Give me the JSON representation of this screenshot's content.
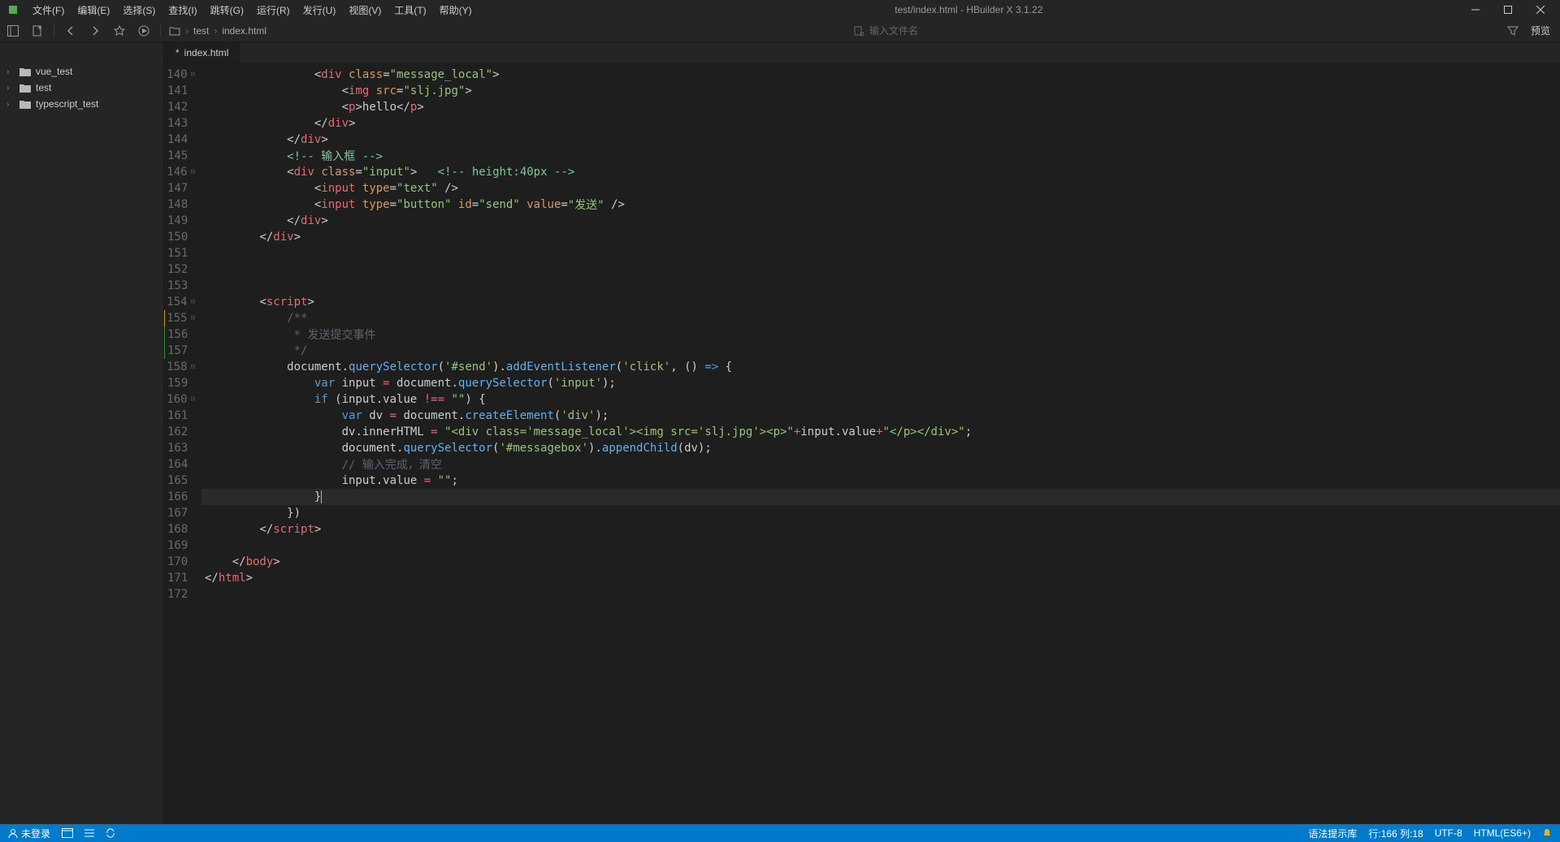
{
  "menubar": {
    "items": [
      "文件(F)",
      "编辑(E)",
      "选择(S)",
      "查找(I)",
      "跳转(G)",
      "运行(R)",
      "发行(U)",
      "视图(V)",
      "工具(T)",
      "帮助(Y)"
    ],
    "title": "test/index.html - HBuilder X 3.1.22"
  },
  "toolbar": {
    "breadcrumb": [
      "test",
      "index.html"
    ],
    "search_placeholder": "输入文件名",
    "preview_label": "预览"
  },
  "sidebar": {
    "items": [
      {
        "label": "vue_test"
      },
      {
        "label": "test"
      },
      {
        "label": "typescript_test"
      }
    ]
  },
  "tabs": {
    "items": [
      {
        "label": "index.html",
        "dirty_prefix": "* "
      }
    ]
  },
  "gutter": {
    "start": 140,
    "end": 172,
    "folds_at": [
      140,
      146,
      154,
      155,
      158,
      160
    ],
    "changes": {
      "155": "orange",
      "156": "green",
      "157": "green"
    }
  },
  "code": {
    "lines": [
      {
        "n": 140,
        "seg": [
          {
            "t": "plain",
            "v": "                "
          },
          {
            "t": "punc",
            "v": "<"
          },
          {
            "t": "tag",
            "v": "div"
          },
          {
            "t": "plain",
            "v": " "
          },
          {
            "t": "attr",
            "v": "class"
          },
          {
            "t": "punc",
            "v": "="
          },
          {
            "t": "str",
            "v": "\"message_local\""
          },
          {
            "t": "punc",
            "v": ">"
          }
        ]
      },
      {
        "n": 141,
        "seg": [
          {
            "t": "plain",
            "v": "                    "
          },
          {
            "t": "punc",
            "v": "<"
          },
          {
            "t": "tag",
            "v": "img"
          },
          {
            "t": "plain",
            "v": " "
          },
          {
            "t": "attr",
            "v": "src"
          },
          {
            "t": "punc",
            "v": "="
          },
          {
            "t": "str",
            "v": "\"slj.jpg\""
          },
          {
            "t": "punc",
            "v": ">"
          }
        ]
      },
      {
        "n": 142,
        "seg": [
          {
            "t": "plain",
            "v": "                    "
          },
          {
            "t": "punc",
            "v": "<"
          },
          {
            "t": "tag",
            "v": "p"
          },
          {
            "t": "punc",
            "v": ">"
          },
          {
            "t": "plain",
            "v": "hello"
          },
          {
            "t": "punc",
            "v": "</"
          },
          {
            "t": "tag",
            "v": "p"
          },
          {
            "t": "punc",
            "v": ">"
          }
        ]
      },
      {
        "n": 143,
        "seg": [
          {
            "t": "plain",
            "v": "                "
          },
          {
            "t": "punc",
            "v": "</"
          },
          {
            "t": "tag",
            "v": "div"
          },
          {
            "t": "punc",
            "v": ">"
          }
        ]
      },
      {
        "n": 144,
        "seg": [
          {
            "t": "plain",
            "v": "            "
          },
          {
            "t": "punc",
            "v": "</"
          },
          {
            "t": "tag",
            "v": "div"
          },
          {
            "t": "punc",
            "v": ">"
          }
        ]
      },
      {
        "n": 145,
        "seg": [
          {
            "t": "plain",
            "v": "            "
          },
          {
            "t": "comment-green",
            "v": "<!-- 输入框 -->"
          }
        ]
      },
      {
        "n": 146,
        "seg": [
          {
            "t": "plain",
            "v": "            "
          },
          {
            "t": "punc",
            "v": "<"
          },
          {
            "t": "tag",
            "v": "div"
          },
          {
            "t": "plain",
            "v": " "
          },
          {
            "t": "attr",
            "v": "class"
          },
          {
            "t": "punc",
            "v": "="
          },
          {
            "t": "str",
            "v": "\"input\""
          },
          {
            "t": "punc",
            "v": ">"
          },
          {
            "t": "plain",
            "v": "   "
          },
          {
            "t": "comment-green",
            "v": "<!-- height:40px -->"
          }
        ]
      },
      {
        "n": 147,
        "seg": [
          {
            "t": "plain",
            "v": "                "
          },
          {
            "t": "punc",
            "v": "<"
          },
          {
            "t": "tag",
            "v": "input"
          },
          {
            "t": "plain",
            "v": " "
          },
          {
            "t": "attr",
            "v": "type"
          },
          {
            "t": "punc",
            "v": "="
          },
          {
            "t": "str",
            "v": "\"text\""
          },
          {
            "t": "plain",
            "v": " "
          },
          {
            "t": "punc",
            "v": "/>"
          }
        ]
      },
      {
        "n": 148,
        "seg": [
          {
            "t": "plain",
            "v": "                "
          },
          {
            "t": "punc",
            "v": "<"
          },
          {
            "t": "tag",
            "v": "input"
          },
          {
            "t": "plain",
            "v": " "
          },
          {
            "t": "attr",
            "v": "type"
          },
          {
            "t": "punc",
            "v": "="
          },
          {
            "t": "str",
            "v": "\"button\""
          },
          {
            "t": "plain",
            "v": " "
          },
          {
            "t": "attr",
            "v": "id"
          },
          {
            "t": "punc",
            "v": "="
          },
          {
            "t": "str",
            "v": "\"send\""
          },
          {
            "t": "plain",
            "v": " "
          },
          {
            "t": "attr",
            "v": "value"
          },
          {
            "t": "punc",
            "v": "="
          },
          {
            "t": "str",
            "v": "\"发送\""
          },
          {
            "t": "plain",
            "v": " "
          },
          {
            "t": "punc",
            "v": "/>"
          }
        ]
      },
      {
        "n": 149,
        "seg": [
          {
            "t": "plain",
            "v": "            "
          },
          {
            "t": "punc",
            "v": "</"
          },
          {
            "t": "tag",
            "v": "div"
          },
          {
            "t": "punc",
            "v": ">"
          }
        ]
      },
      {
        "n": 150,
        "seg": [
          {
            "t": "plain",
            "v": "        "
          },
          {
            "t": "punc",
            "v": "</"
          },
          {
            "t": "tag",
            "v": "div"
          },
          {
            "t": "punc",
            "v": ">"
          }
        ]
      },
      {
        "n": 151,
        "seg": [
          {
            "t": "plain",
            "v": ""
          }
        ]
      },
      {
        "n": 152,
        "seg": [
          {
            "t": "plain",
            "v": ""
          }
        ]
      },
      {
        "n": 153,
        "seg": [
          {
            "t": "plain",
            "v": ""
          }
        ]
      },
      {
        "n": 154,
        "seg": [
          {
            "t": "plain",
            "v": "        "
          },
          {
            "t": "punc",
            "v": "<"
          },
          {
            "t": "tag",
            "v": "script"
          },
          {
            "t": "punc",
            "v": ">"
          }
        ]
      },
      {
        "n": 155,
        "seg": [
          {
            "t": "plain",
            "v": "            "
          },
          {
            "t": "comment",
            "v": "/**"
          }
        ]
      },
      {
        "n": 156,
        "seg": [
          {
            "t": "plain",
            "v": "            "
          },
          {
            "t": "comment",
            "v": " * 发送提交事件"
          }
        ]
      },
      {
        "n": 157,
        "seg": [
          {
            "t": "plain",
            "v": "            "
          },
          {
            "t": "comment",
            "v": " */"
          }
        ]
      },
      {
        "n": 158,
        "seg": [
          {
            "t": "plain",
            "v": "            "
          },
          {
            "t": "plain",
            "v": "document"
          },
          {
            "t": "punc",
            "v": "."
          },
          {
            "t": "func",
            "v": "querySelector"
          },
          {
            "t": "punc",
            "v": "("
          },
          {
            "t": "str",
            "v": "'#send'"
          },
          {
            "t": "punc",
            "v": ")."
          },
          {
            "t": "func",
            "v": "addEventListener"
          },
          {
            "t": "punc",
            "v": "("
          },
          {
            "t": "str",
            "v": "'click'"
          },
          {
            "t": "punc",
            "v": ", () "
          },
          {
            "t": "kw",
            "v": "=>"
          },
          {
            "t": "punc",
            "v": " {"
          }
        ]
      },
      {
        "n": 159,
        "seg": [
          {
            "t": "plain",
            "v": "                "
          },
          {
            "t": "kw",
            "v": "var"
          },
          {
            "t": "plain",
            "v": " input "
          },
          {
            "t": "op",
            "v": "="
          },
          {
            "t": "plain",
            "v": " document"
          },
          {
            "t": "punc",
            "v": "."
          },
          {
            "t": "func",
            "v": "querySelector"
          },
          {
            "t": "punc",
            "v": "("
          },
          {
            "t": "str",
            "v": "'input'"
          },
          {
            "t": "punc",
            "v": ");"
          }
        ]
      },
      {
        "n": 160,
        "seg": [
          {
            "t": "plain",
            "v": "                "
          },
          {
            "t": "kw",
            "v": "if"
          },
          {
            "t": "punc",
            "v": " ("
          },
          {
            "t": "plain",
            "v": "input"
          },
          {
            "t": "punc",
            "v": "."
          },
          {
            "t": "plain",
            "v": "value "
          },
          {
            "t": "op",
            "v": "!=="
          },
          {
            "t": "plain",
            "v": " "
          },
          {
            "t": "str",
            "v": "\"\""
          },
          {
            "t": "punc",
            "v": ") {"
          }
        ]
      },
      {
        "n": 161,
        "seg": [
          {
            "t": "plain",
            "v": "                    "
          },
          {
            "t": "kw",
            "v": "var"
          },
          {
            "t": "plain",
            "v": " dv "
          },
          {
            "t": "op",
            "v": "="
          },
          {
            "t": "plain",
            "v": " document"
          },
          {
            "t": "punc",
            "v": "."
          },
          {
            "t": "func",
            "v": "createElement"
          },
          {
            "t": "punc",
            "v": "("
          },
          {
            "t": "str",
            "v": "'div'"
          },
          {
            "t": "punc",
            "v": ");"
          }
        ]
      },
      {
        "n": 162,
        "seg": [
          {
            "t": "plain",
            "v": "                    dv"
          },
          {
            "t": "punc",
            "v": "."
          },
          {
            "t": "plain",
            "v": "innerHTML "
          },
          {
            "t": "op",
            "v": "="
          },
          {
            "t": "plain",
            "v": " "
          },
          {
            "t": "str",
            "v": "\"<div class='message_local'><img src='slj.jpg'><p>\""
          },
          {
            "t": "op",
            "v": "+"
          },
          {
            "t": "plain",
            "v": "input"
          },
          {
            "t": "punc",
            "v": "."
          },
          {
            "t": "plain",
            "v": "value"
          },
          {
            "t": "op",
            "v": "+"
          },
          {
            "t": "str",
            "v": "\"</p></div>\""
          },
          {
            "t": "punc",
            "v": ";"
          }
        ]
      },
      {
        "n": 163,
        "seg": [
          {
            "t": "plain",
            "v": "                    document"
          },
          {
            "t": "punc",
            "v": "."
          },
          {
            "t": "func",
            "v": "querySelector"
          },
          {
            "t": "punc",
            "v": "("
          },
          {
            "t": "str",
            "v": "'#messagebox'"
          },
          {
            "t": "punc",
            "v": ")."
          },
          {
            "t": "func",
            "v": "appendChild"
          },
          {
            "t": "punc",
            "v": "("
          },
          {
            "t": "plain",
            "v": "dv"
          },
          {
            "t": "punc",
            "v": ");"
          }
        ]
      },
      {
        "n": 164,
        "seg": [
          {
            "t": "plain",
            "v": "                    "
          },
          {
            "t": "comment",
            "v": "// 输入完成，清空"
          }
        ]
      },
      {
        "n": 165,
        "seg": [
          {
            "t": "plain",
            "v": "                    input"
          },
          {
            "t": "punc",
            "v": "."
          },
          {
            "t": "plain",
            "v": "value "
          },
          {
            "t": "op",
            "v": "="
          },
          {
            "t": "plain",
            "v": " "
          },
          {
            "t": "str",
            "v": "\"\""
          },
          {
            "t": "punc",
            "v": ";"
          }
        ]
      },
      {
        "n": 166,
        "current": true,
        "seg": [
          {
            "t": "plain",
            "v": "                "
          },
          {
            "t": "punc",
            "v": "}"
          },
          {
            "t": "cursor",
            "v": ""
          }
        ]
      },
      {
        "n": 167,
        "seg": [
          {
            "t": "plain",
            "v": "            "
          },
          {
            "t": "punc",
            "v": "})"
          }
        ]
      },
      {
        "n": 168,
        "seg": [
          {
            "t": "plain",
            "v": "        "
          },
          {
            "t": "punc",
            "v": "</"
          },
          {
            "t": "tag",
            "v": "script"
          },
          {
            "t": "punc",
            "v": ">"
          }
        ]
      },
      {
        "n": 169,
        "seg": [
          {
            "t": "plain",
            "v": ""
          }
        ]
      },
      {
        "n": 170,
        "seg": [
          {
            "t": "plain",
            "v": "    "
          },
          {
            "t": "punc",
            "v": "</"
          },
          {
            "t": "tag",
            "v": "body"
          },
          {
            "t": "punc",
            "v": ">"
          }
        ]
      },
      {
        "n": 171,
        "seg": [
          {
            "t": "punc",
            "v": "</"
          },
          {
            "t": "tag",
            "v": "html"
          },
          {
            "t": "punc",
            "v": ">"
          }
        ]
      },
      {
        "n": 172,
        "seg": [
          {
            "t": "plain",
            "v": ""
          }
        ]
      }
    ]
  },
  "statusbar": {
    "login": "未登录",
    "grammar": "语法提示库",
    "rowcol": "行:166 列:18",
    "encoding": "UTF-8",
    "language": "HTML(ES6+)"
  }
}
